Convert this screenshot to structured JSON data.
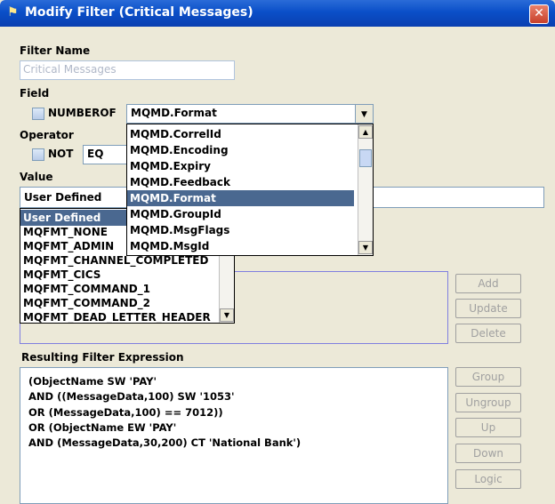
{
  "window": {
    "title": "Modify Filter (Critical Messages)",
    "close_symbol": "✕",
    "title_icon": "filter-icon"
  },
  "filter_name": {
    "label": "Filter Name",
    "mnemonic": "i",
    "value": "Critical Messages"
  },
  "field": {
    "label": "Field",
    "numberof_label": "NUMBEROF",
    "combo_value": "MQMD.Format",
    "dropdown_items": [
      "MQMD.CorrelId",
      "MQMD.Encoding",
      "MQMD.Expiry",
      "MQMD.Feedback",
      "MQMD.Format",
      "MQMD.GroupId",
      "MQMD.MsgFlags",
      "MQMD.MsgId"
    ],
    "selected_index": 4
  },
  "operator": {
    "label": "Operator",
    "not_label": "NOT",
    "value": "EQ"
  },
  "value": {
    "label": "Value",
    "combo_value": "User Defined",
    "dropdown_items": [
      "User Defined",
      "MQFMT_NONE",
      "MQFMT_ADMIN",
      "MQFMT_CHANNEL_COMPLETED",
      "MQFMT_CICS",
      "MQFMT_COMMAND_1",
      "MQFMT_COMMAND_2",
      "MQFMT_DEAD_LETTER_HEADER"
    ],
    "selected_index": 0
  },
  "buttons": {
    "add": "Add",
    "update": "Update",
    "delete": "Delete",
    "group": "Group",
    "ungroup": "Ungroup",
    "up": "Up",
    "down": "Down",
    "logic": "Logic"
  },
  "resulting": {
    "label": "Resulting Filter Expression",
    "lines": [
      "(ObjectName SW 'PAY'",
      "AND ((MessageData,100) SW '1053'",
      "OR (MessageData,100) == 7012))",
      "OR (ObjectName EW 'PAY'",
      "AND (MessageData,30,200) CT 'National Bank')"
    ]
  },
  "colors": {
    "title_bar": "#0a4fc8",
    "selection": "#4a6890",
    "dialog_bg": "#ece9d8"
  }
}
